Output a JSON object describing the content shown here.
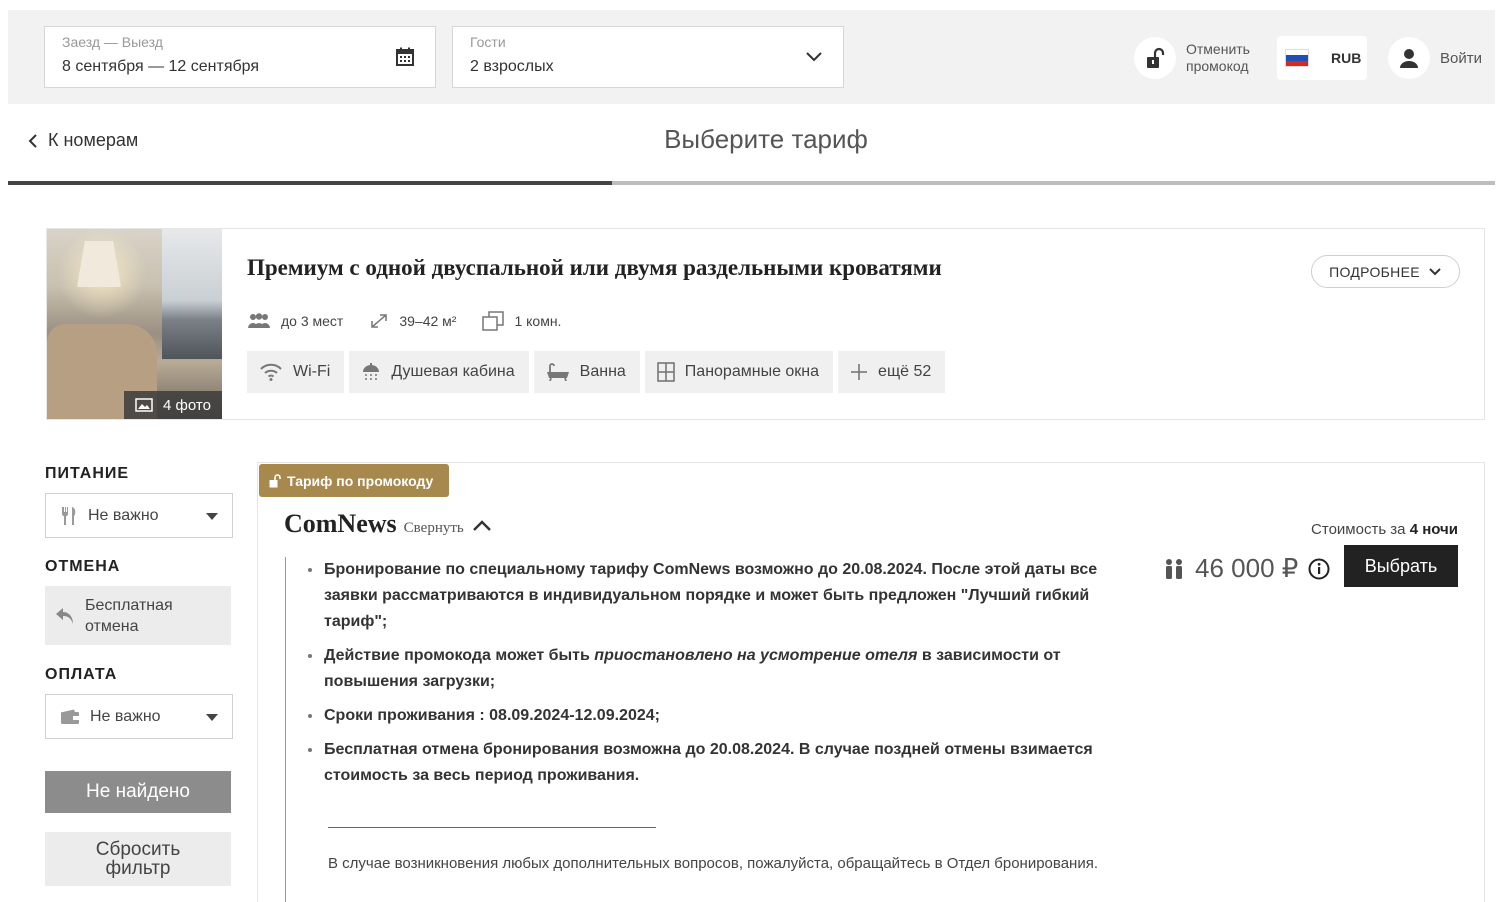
{
  "search": {
    "dates_label": "Заезд — Выезд",
    "dates_value": "8 сентября — 12 сентября",
    "guests_label": "Гости",
    "guests_value": "2 взрослых"
  },
  "header": {
    "promo_cancel_line1": "Отменить",
    "promo_cancel_line2": "промокод",
    "currency": "RUB",
    "login": "Войти",
    "back_label": "К номерам",
    "page_title": "Выберите тариф",
    "progress_fraction": 0.406
  },
  "room": {
    "name": "Премиум с одной двуспальной или двумя раздельными кроватями",
    "details_button": "ПОДРОБНЕЕ",
    "photo_count": "4 фото",
    "specs": {
      "capacity": "до 3 мест",
      "area": "39–42 м²",
      "rooms": "1 комн."
    },
    "amenities": [
      "Wi-Fi",
      "Душевая кабина",
      "Ванна",
      "Панорамные окна",
      "ещё 52"
    ]
  },
  "filters": {
    "meal_title": "ПИТАНИЕ",
    "meal_value": "Не важно",
    "cancel_title": "ОТМЕНА",
    "cancel_option_line1": "Бесплатная",
    "cancel_option_line2": "отмена",
    "payment_title": "ОПЛАТА",
    "payment_value": "Не важно",
    "not_found_button": "Не найдено",
    "reset_line1": "Сбросить",
    "reset_line2": "фильтр"
  },
  "tariff": {
    "badge": "Тариф по промокоду",
    "name": "ComNews",
    "collapse": "Свернуть",
    "cost_prefix": "Стоимость за",
    "cost_nights": "4 ночи",
    "price": "46 000 ₽",
    "select_button": "Выбрать",
    "bullets": {
      "b1": "Бронирование по специальному тарифу ComNews возможно до 20.08.2024.  После этой даты все заявки рассматриваются в индивидуальном порядке и может быть предложен \"Лучший гибкий тариф\";",
      "b2_pre": "Действие промокода может быть ",
      "b2_em": "приостановлено на усмотрение отеля",
      "b2_post": " в зависимости от повышения загрузки;",
      "b3": "Сроки проживания :  08.09.2024-12.09.2024;",
      "b4": "Бесплатная отмена бронирования возможна до 20.08.2024. В случае поздней отмены взимается стоимость за весь период проживания."
    },
    "note": "В случае возникновения любых дополнительных вопросов, пожалуйста, обращайтесь в Отдел бронирования."
  },
  "colors": {
    "topbar_bg": "#f2f2f2",
    "badge_gold": "#a7884d",
    "select_button_bg": "#222222",
    "flag_white": "#ffffff",
    "flag_blue": "#1f4fb5",
    "flag_red": "#d52b1e"
  },
  "icons": [
    "calendar-icon",
    "chevron-down-icon",
    "unlock-icon",
    "user-icon",
    "chevron-left-icon",
    "image-icon",
    "people-icon",
    "expand-icon",
    "room-icon",
    "wifi-icon",
    "shower-icon",
    "bath-icon",
    "window-icon",
    "plus-icon",
    "fork-knife-icon",
    "undo-icon",
    "wallet-icon",
    "guests-icon",
    "info-icon",
    "chevron-up-icon"
  ]
}
